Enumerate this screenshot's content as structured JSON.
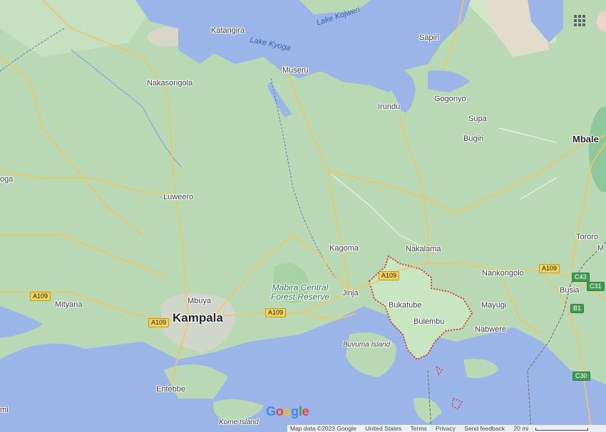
{
  "map": {
    "cities": [
      {
        "name": "Katangira"
      },
      {
        "name": "Nakasongola"
      },
      {
        "name": "Museru"
      },
      {
        "name": "Sapiri"
      },
      {
        "name": "Gogonyo"
      },
      {
        "name": "Irundu"
      },
      {
        "name": "Supa"
      },
      {
        "name": "Bugiri"
      },
      {
        "name": "Mbale"
      },
      {
        "name": "Luweero"
      },
      {
        "name": "Tororo"
      },
      {
        "name": "Kagoma"
      },
      {
        "name": "Nakalama"
      },
      {
        "name": "Nankongolo"
      },
      {
        "name": "Mbuya"
      },
      {
        "name": "Kampala"
      },
      {
        "name": "Mityana"
      },
      {
        "name": "Jinja"
      },
      {
        "name": "Bukatube"
      },
      {
        "name": "Bulembu"
      },
      {
        "name": "Mayugi"
      },
      {
        "name": "Nabwere"
      },
      {
        "name": "Busia"
      },
      {
        "name": "Entebbe"
      },
      {
        "name": "M"
      },
      {
        "name": "oga"
      },
      {
        "name": "mi"
      }
    ],
    "water_labels": [
      "Lake Kojweri",
      "Lake Kyoga"
    ],
    "island_labels": [
      "Buvuma Island",
      "Kome Island"
    ],
    "park_label": "Mabira Central\nForest Reserve",
    "road_shields": [
      "A109",
      "A109",
      "A109",
      "A109",
      "A109",
      "A109",
      "C43",
      "C31",
      "B1",
      "C30"
    ]
  },
  "colors": {
    "land": "#b9d9b4",
    "water": "#9cb5e9",
    "road": "#f5c55a",
    "highlight": "#d23c3c",
    "forest": "#8ec79a"
  },
  "icons": {
    "apps": "apps-grid-icon",
    "account": "account-avatar-icon"
  },
  "branding": {
    "logo": "Google"
  },
  "footer": {
    "map_data": "Map data ©2023 Google",
    "region": "United States",
    "terms": "Terms",
    "privacy": "Privacy",
    "feedback": "Send feedback",
    "scale": "20 mi"
  }
}
